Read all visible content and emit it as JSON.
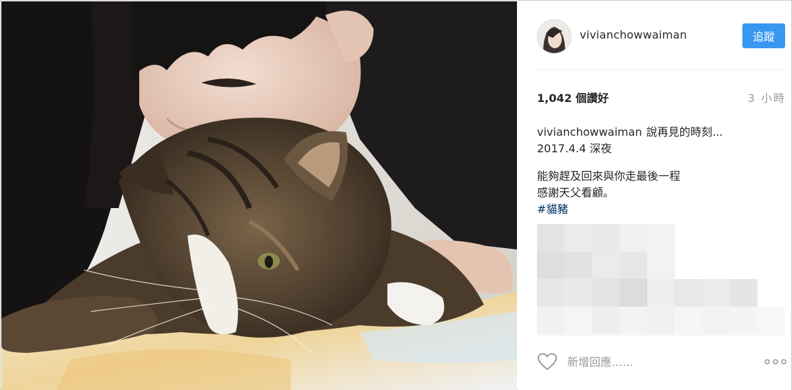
{
  "post": {
    "username": "vivianchowwaiman",
    "follow_label": "追蹤",
    "likes": "1,042 個讚好",
    "time": "3 小時",
    "caption": {
      "username": "vivianchowwaiman",
      "lines": [
        "說再見的時刻...",
        "2017.4.4 深夜",
        "能夠趕及回來與你走最後一程",
        "感謝天父看顧。"
      ],
      "hashtag": "#貓豬"
    },
    "comment_placeholder": "新增回應……"
  },
  "icons": {
    "like": "heart-icon",
    "more": "more-options-icon",
    "avatar": "avatar"
  },
  "colors": {
    "follow_button": "#3897f0",
    "hashtag": "#003569",
    "muted_text": "#999999"
  }
}
